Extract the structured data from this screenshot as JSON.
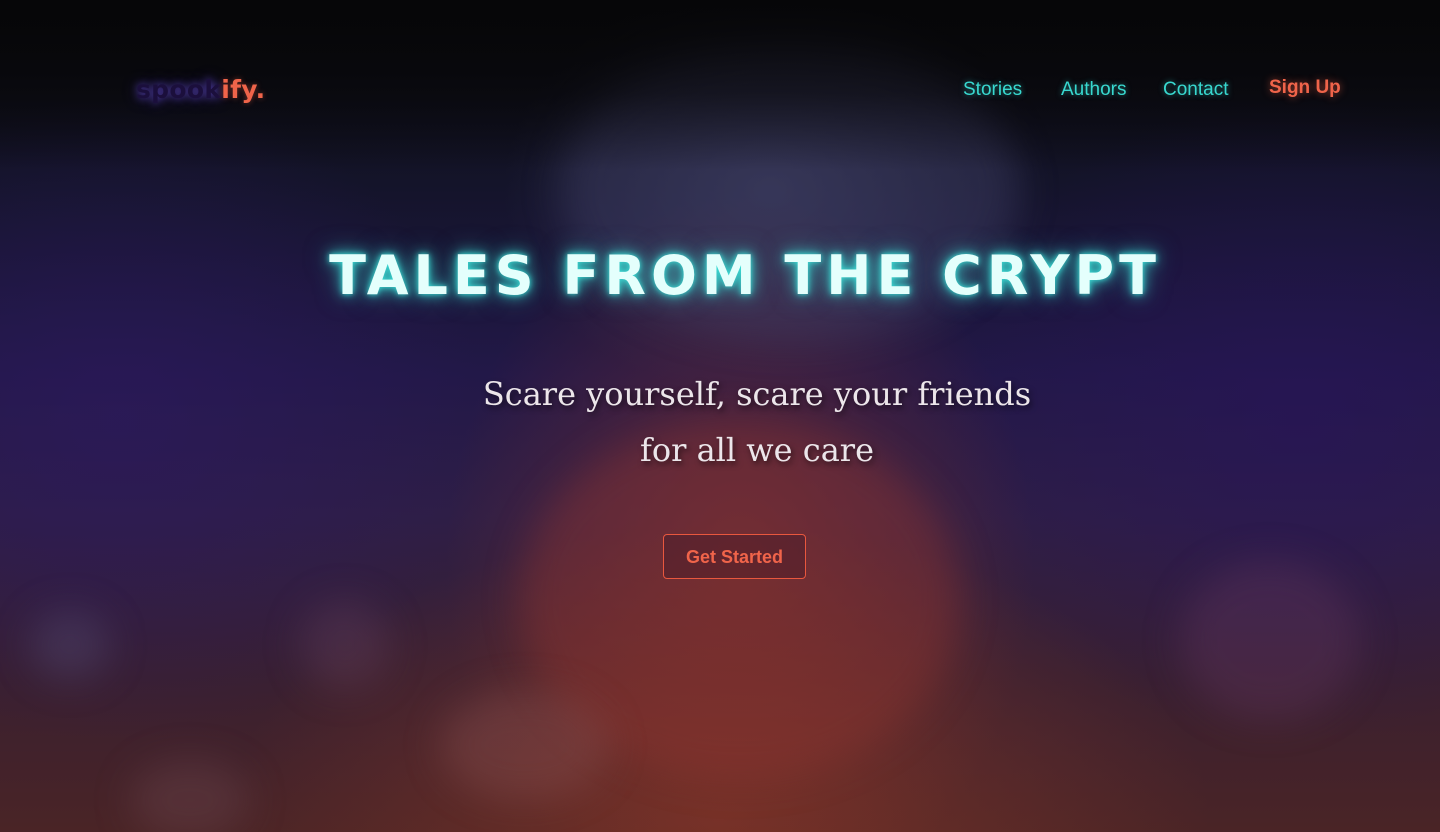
{
  "brand": {
    "logo_part1": "spook",
    "logo_part2": "ify."
  },
  "nav": {
    "items": [
      {
        "label": "Stories"
      },
      {
        "label": "Authors"
      },
      {
        "label": "Contact"
      }
    ],
    "signup_label": "Sign Up"
  },
  "hero": {
    "title": "Tales from the Crypt",
    "subtitle_line1": "Scare yourself, scare your friends",
    "subtitle_line2": "for all we care",
    "cta_label": "Get Started"
  },
  "colors": {
    "accent_teal": "#38d8cf",
    "accent_orange": "#f0644a",
    "logo_dark": "#1b0f3c",
    "background_dark": "#0a0a12"
  }
}
